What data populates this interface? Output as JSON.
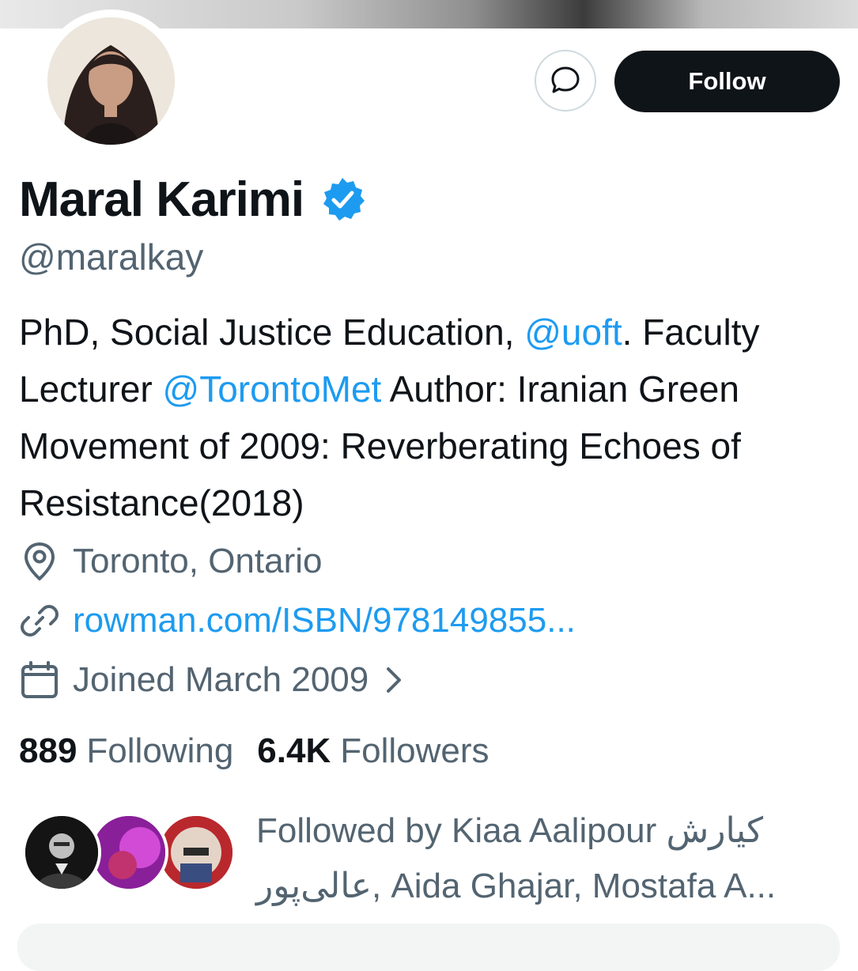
{
  "profile": {
    "name": "Maral Karimi",
    "handle": "@maralkay",
    "follow_label": "Follow",
    "bio": {
      "part1": "PhD, Social Justice Education, ",
      "mention1": "@uoft",
      "part2": ". Faculty Lecturer ",
      "mention2": "@TorontoMet",
      "part3": " Author: Iranian Green Movement of 2009: Reverberating Echoes of Resistance(2018)"
    },
    "location": "Toronto, Ontario",
    "url": "rowman.com/ISBN/978149855...",
    "joined": "Joined March 2009"
  },
  "stats": {
    "following_count": "889",
    "following_label": "Following",
    "followers_count": "6.4K",
    "followers_label": "Followers"
  },
  "followed_by": {
    "text": "Followed by Kiaa Aalipour كيارش عالی‌پور, Aida Ghajar, Mostafa A..."
  },
  "icons": {
    "message": "message-icon",
    "verified": "verified-badge-icon",
    "location": "location-pin-icon",
    "link": "link-icon",
    "calendar": "calendar-icon",
    "chevron": "chevron-right-icon"
  },
  "colors": {
    "accent": "#1d9bf0",
    "text": "#0f1419",
    "secondary": "#536471",
    "button": "#0f1419"
  }
}
